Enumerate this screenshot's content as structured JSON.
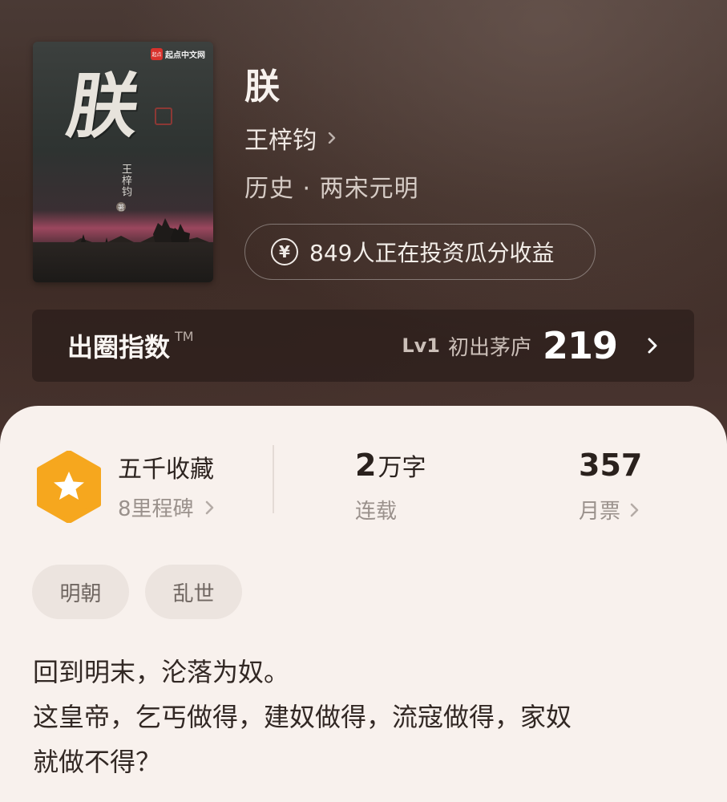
{
  "book": {
    "cover": {
      "title": "朕",
      "author": "王梓钧",
      "author_mark": "著",
      "publisher": "起点中文网",
      "publisher_logo": "起点"
    },
    "title": "朕",
    "author": "王梓钧",
    "category": "历史 · 两宋元明",
    "invest": {
      "icon": "yen-icon",
      "text": "849人正在投资瓜分收益"
    }
  },
  "index": {
    "title": "出圈指数",
    "tm": "TM",
    "lv": "Lv1",
    "level_name": "初出茅庐",
    "score": "219"
  },
  "stats": {
    "favorites": {
      "title": "五千收藏",
      "subtitle": "8里程碑",
      "badge_icon": "star-hexagon-icon",
      "badge_color": "#f6a71e"
    },
    "words": {
      "number": "2",
      "unit": "万字",
      "label": "连载"
    },
    "votes": {
      "number": "357",
      "label": "月票"
    }
  },
  "tags": [
    "明朝",
    "乱世"
  ],
  "description": {
    "line1": "回到明末，沦落为奴。",
    "line2": "这皇帝，乞丐做得，建奴做得，流寇做得，家奴",
    "line3": "就做不得？"
  }
}
